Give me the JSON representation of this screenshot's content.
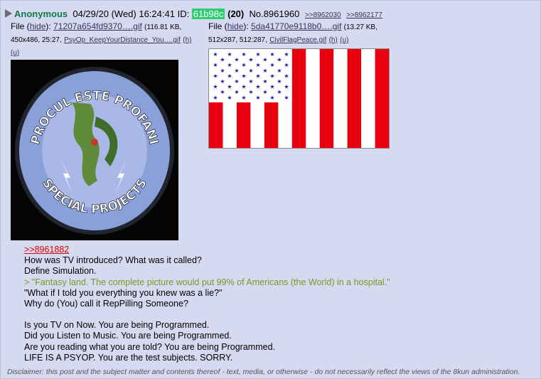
{
  "header": {
    "name": "Anonymous",
    "datetime": "04/29/20 (Wed) 16:24:41",
    "id_label": "ID:",
    "id_value": "61b98c",
    "post_count": "(20)",
    "post_number": "No.8961960",
    "backlink1": ">>8962030",
    "backlink2": ">>8962177"
  },
  "file1": {
    "label": "File",
    "hide": "hide",
    "filename": "71207a654fd9370….gif",
    "size": "(116.81 KB,",
    "dims": "450x486, 25:27,",
    "orig_name": "PsyOp_KeepYourDistance_You….gif",
    "h": "(h)",
    "u": "(u)",
    "image_text_top": "PROCUL ESTE PROFANI",
    "image_text_bottom": "SPECIAL PROJECTS"
  },
  "file2": {
    "label": "File",
    "hide": "hide",
    "filename": "5da41770e9118b0….gif",
    "size": "(13.27 KB,",
    "dims": "512x287, 512:287,",
    "orig_name": "CivilFlagPeace.gif",
    "h": "(h)",
    "u": "(u)"
  },
  "body": {
    "reply_link": ">>8961882",
    "lines": [
      "How was TV introduced? What was it called?",
      "Define Simulation.",
      "> \"Fantasy land. The complete picture would put 99% of Americans (the World) in a hospital.\"",
      "\"What if I told you everything you knew was a lie?\"",
      "Why do (You) call it RepPilling Someone?",
      "Is you TV on Now. You are being Programmed.",
      "Did you Listen to Music. You are being Programmed.",
      "Are you reading what you are told? You are being Programmed.",
      "LIFE IS A PSYOP. You are the test subjects. SORRY."
    ]
  },
  "disclaimer": "Disclaimer: this post and the subject matter and contents thereof - text, media, or otherwise - do not necessarily reflect the views of the 8kun administration.",
  "colors": {
    "post_bg": "#d6daf0",
    "name": "#117743",
    "id_bg": "#2ecc71",
    "quote": "#789922",
    "reply_link": "#dd0000",
    "flag_red": "#e8000f",
    "flag_blue": "#1a1a9c"
  }
}
